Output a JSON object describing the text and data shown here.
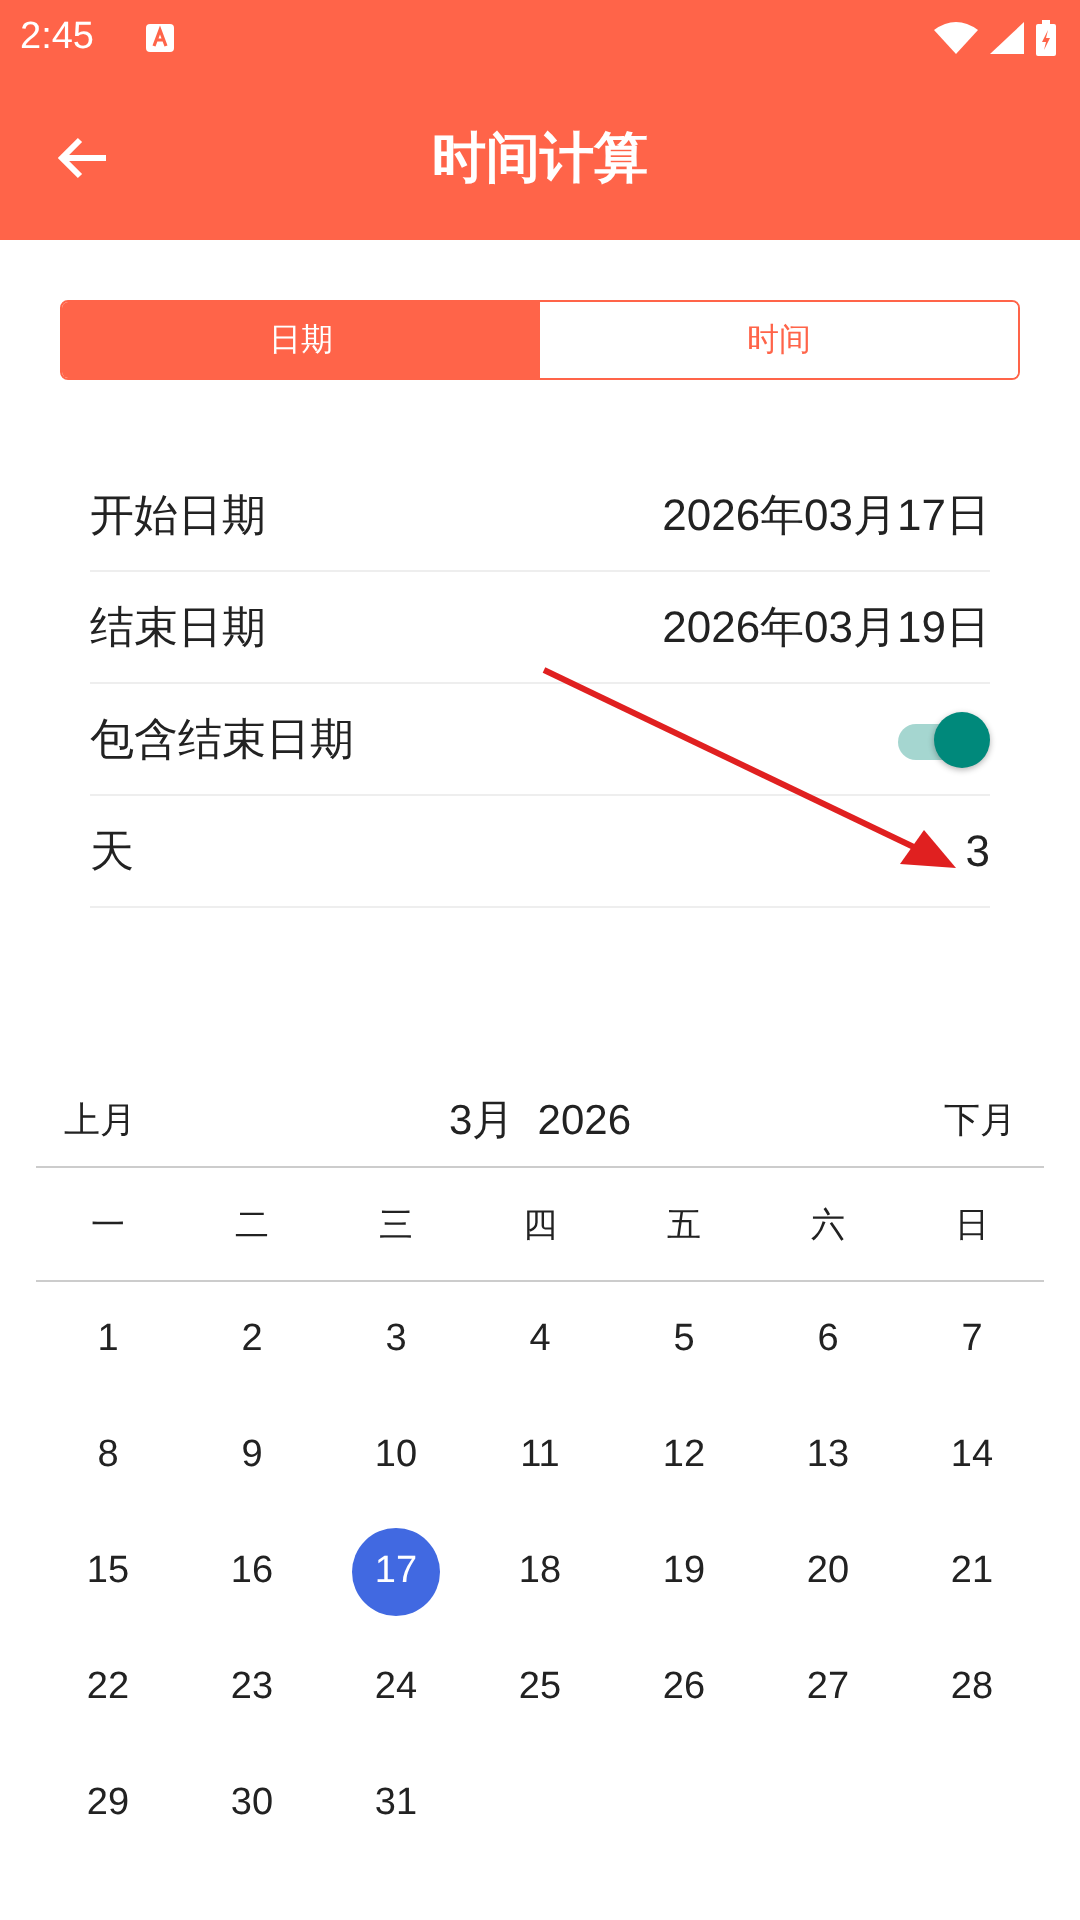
{
  "status_bar": {
    "time": "2:45"
  },
  "app_bar": {
    "title": "时间计算"
  },
  "tabs": [
    {
      "label": "日期",
      "selected": true
    },
    {
      "label": "时间",
      "selected": false
    }
  ],
  "rows": [
    {
      "kind": "value",
      "label": "开始日期",
      "value": "2026年03月17日"
    },
    {
      "kind": "value",
      "label": "结束日期",
      "value": "2026年03月19日"
    },
    {
      "kind": "switch",
      "label": "包含结束日期",
      "on": true
    },
    {
      "kind": "value",
      "label": "天",
      "value": "3"
    }
  ],
  "calendar": {
    "prev": "上月",
    "title": "3月  2026",
    "next": "下月",
    "weekdays": [
      "一",
      "二",
      "三",
      "四",
      "五",
      "六",
      "日"
    ],
    "weeks": [
      [
        {
          "day": "1",
          "selected": false
        },
        {
          "day": "2",
          "selected": false
        },
        {
          "day": "3",
          "selected": false
        },
        {
          "day": "4",
          "selected": false
        },
        {
          "day": "5",
          "selected": false
        },
        {
          "day": "6",
          "selected": false
        },
        {
          "day": "7",
          "selected": false
        }
      ],
      [
        {
          "day": "8",
          "selected": false
        },
        {
          "day": "9",
          "selected": false
        },
        {
          "day": "10",
          "selected": false
        },
        {
          "day": "11",
          "selected": false
        },
        {
          "day": "12",
          "selected": false
        },
        {
          "day": "13",
          "selected": false
        },
        {
          "day": "14",
          "selected": false
        }
      ],
      [
        {
          "day": "15",
          "selected": false
        },
        {
          "day": "16",
          "selected": false
        },
        {
          "day": "17",
          "selected": true
        },
        {
          "day": "18",
          "selected": false
        },
        {
          "day": "19",
          "selected": false
        },
        {
          "day": "20",
          "selected": false
        },
        {
          "day": "21",
          "selected": false
        }
      ],
      [
        {
          "day": "22",
          "selected": false
        },
        {
          "day": "23",
          "selected": false
        },
        {
          "day": "24",
          "selected": false
        },
        {
          "day": "25",
          "selected": false
        },
        {
          "day": "26",
          "selected": false
        },
        {
          "day": "27",
          "selected": false
        },
        {
          "day": "28",
          "selected": false
        }
      ],
      [
        {
          "day": "29",
          "selected": false
        },
        {
          "day": "30",
          "selected": false
        },
        {
          "day": "31",
          "selected": false
        }
      ]
    ]
  }
}
